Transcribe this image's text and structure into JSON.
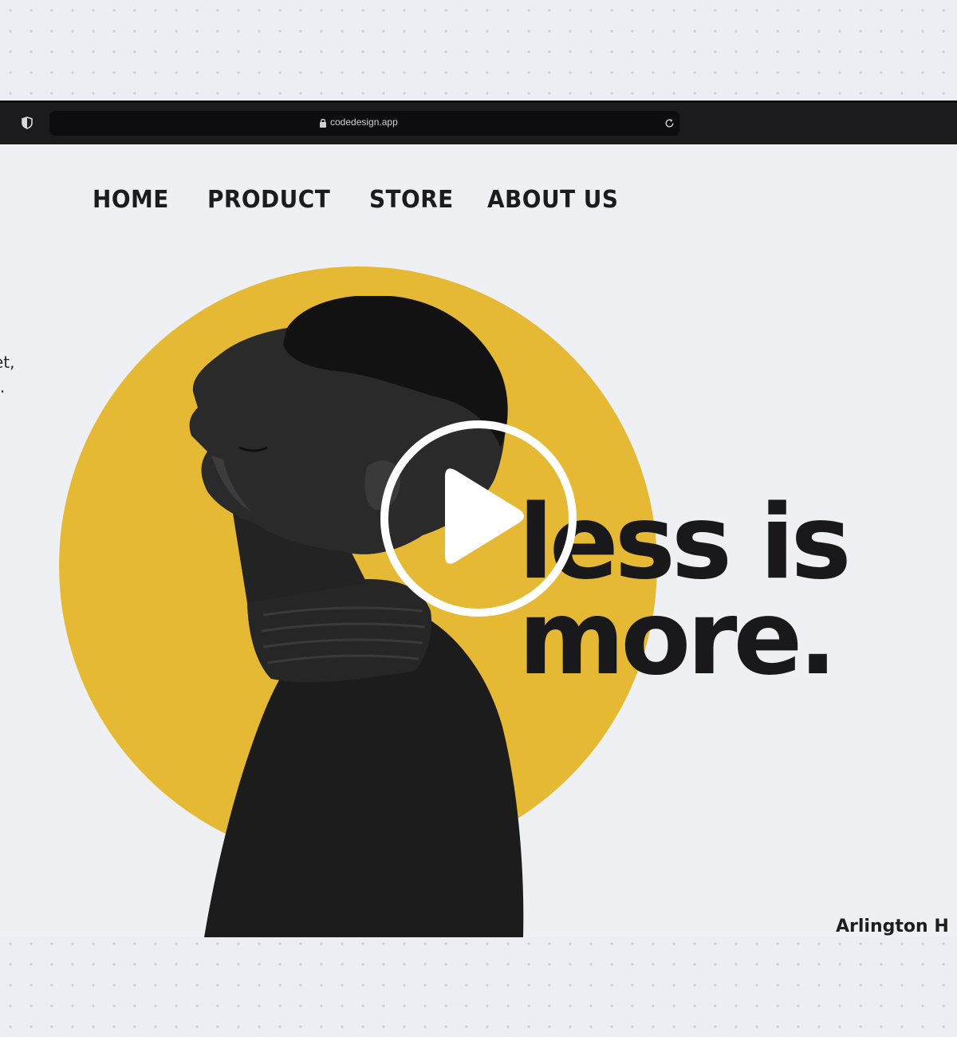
{
  "browser": {
    "url": "codedesign.app",
    "icons": [
      "shield-icon",
      "lock-icon",
      "reload-icon"
    ]
  },
  "nav": {
    "items": [
      {
        "label": "HOME"
      },
      {
        "label": "PRODUCT"
      },
      {
        "label": "STORE"
      },
      {
        "label": "ABOUT US"
      }
    ]
  },
  "hero": {
    "side_text_line1": "et,",
    "side_text_line2": "t.",
    "headline_line1": "less is",
    "headline_line2": "more.",
    "caption": "Arlington H",
    "accent_color": "#e6b935",
    "text_color": "#19191b"
  },
  "overlay": {
    "play_icon": "play-icon"
  }
}
